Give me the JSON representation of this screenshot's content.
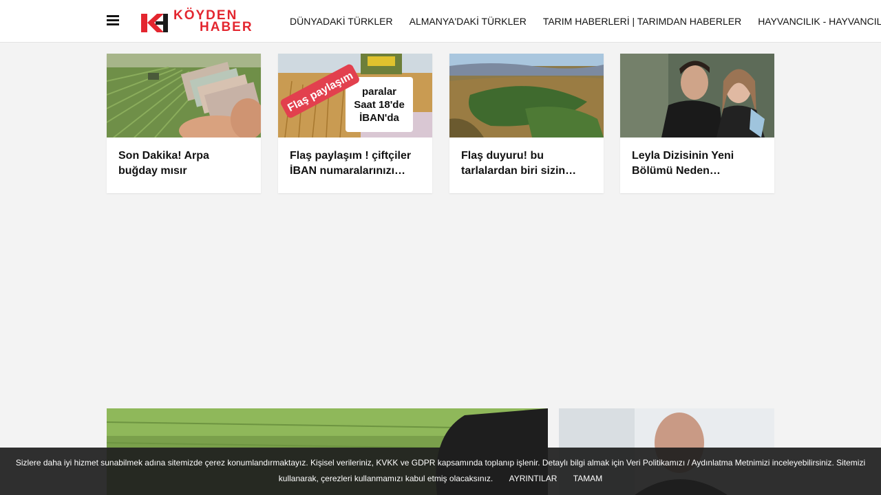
{
  "header": {
    "logo_top": "KÖYDEN",
    "logo_bottom": "HABER",
    "nav": [
      "DÜNYADAKİ TÜRKLER",
      "ALMANYA'DAKİ TÜRKLER",
      "TARIM HABERLERİ | TARIMDAN HABERLER",
      "HAYVANCILIK - HAYVANCILIK HABERLERİ"
    ]
  },
  "cards": [
    {
      "title": "Son Dakika! Arpa buğday mısır üreticilerine para…"
    },
    {
      "title": "Flaş paylaşım ! çiftçiler İBAN numaralarınızı…",
      "badge": "Flaş paylaşım",
      "note_l1": "paralar",
      "note_l2": "Saat 18'de",
      "note_l3": "İBAN'da"
    },
    {
      "title": "Flaş duyuru! bu tarlalardan biri sizin…"
    },
    {
      "title": "Leyla Dizisinin Yeni Bölümü Neden…"
    }
  ],
  "cookie": {
    "text": "Sizlere daha iyi hizmet sunabilmek adına sitemizde çerez konumlandırmaktayız. Kişisel verileriniz, KVKK ve GDPR kapsamında toplanıp işlenir. Detaylı bilgi almak için Veri Politikamızı / Aydınlatma Metnimizi inceleyebilirsiniz. Sitemizi kullanarak, çerezleri kullanmamızı kabul etmiş olacaksınız.",
    "details_label": "AYRINTILAR",
    "ok_label": "TAMAM"
  },
  "colors": {
    "brand": "#e3262f",
    "background": "#f3f3f3"
  }
}
